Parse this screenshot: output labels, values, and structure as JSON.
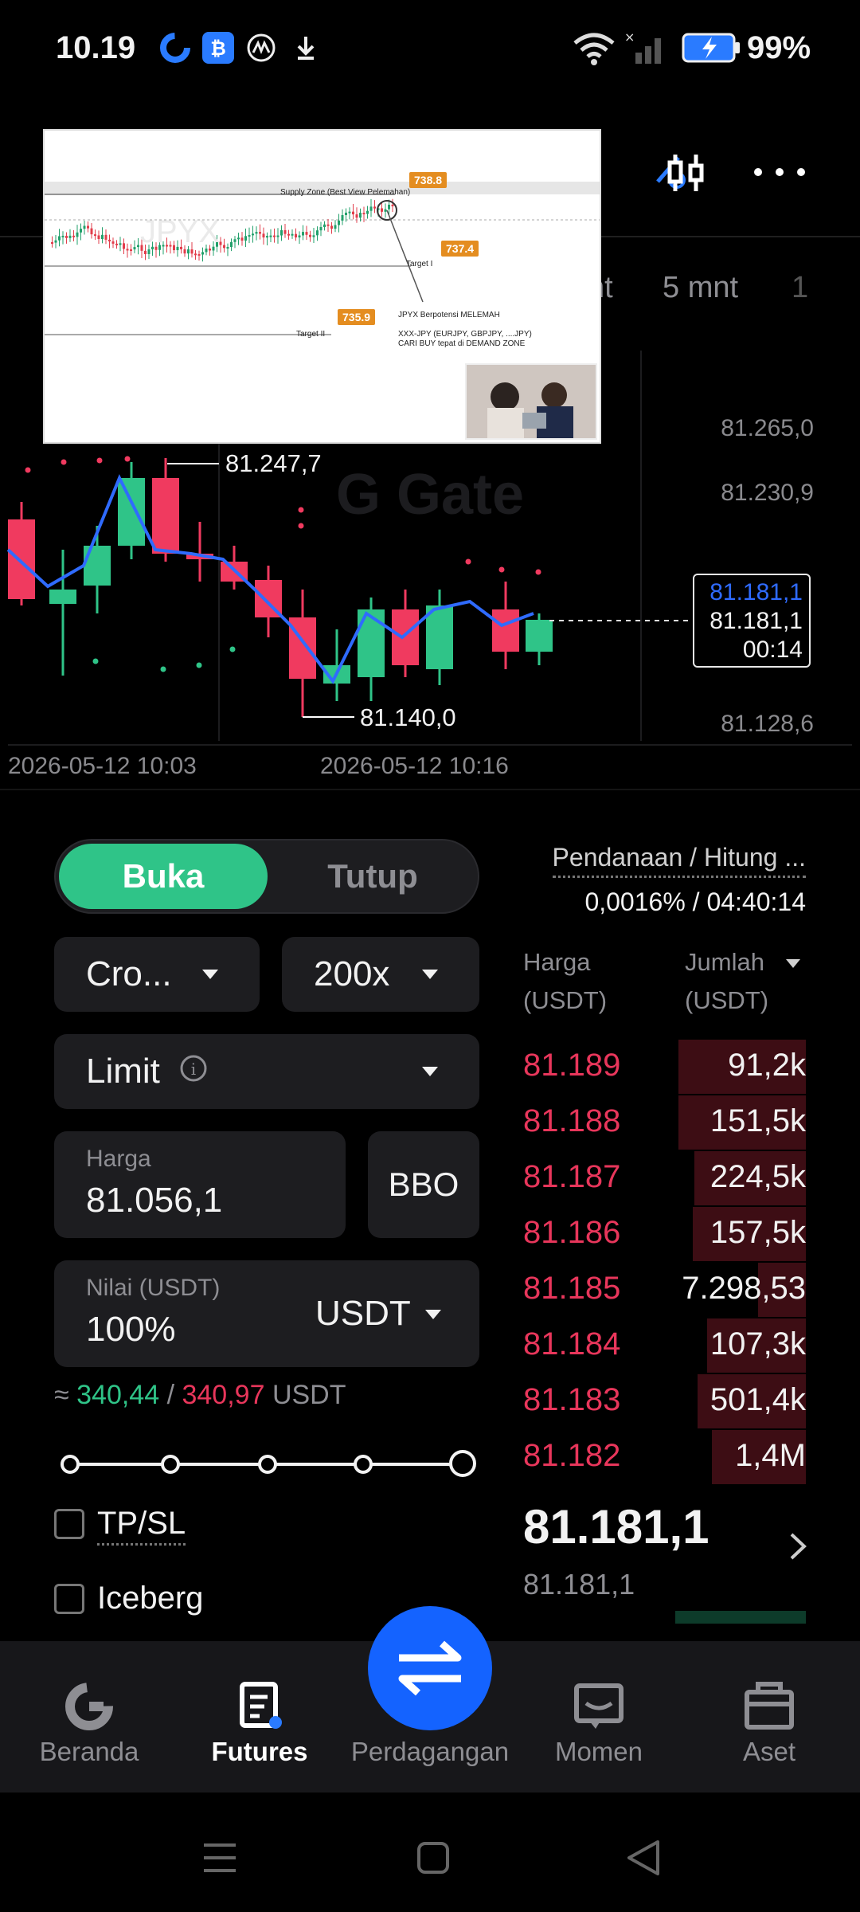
{
  "status_bar": {
    "time": "10.19",
    "battery": "99%"
  },
  "header": {
    "timeframe_tabs": [
      "nt",
      "5 mnt",
      "1"
    ]
  },
  "chart": {
    "price_axis": [
      "81.265,0",
      "81.230,9",
      "81.1??,?",
      "81.1??,?",
      "81.128,6"
    ],
    "high_label": "81.247,7",
    "low_label": "81.140,0",
    "current_blue": "81.181,1",
    "current_white": "81.181,1",
    "countdown": "00:14",
    "time_labels": [
      "2026-05-12 10:03",
      "2026-05-12 10:16"
    ],
    "watermark": "Gate"
  },
  "video_overlay": {
    "supply_zone": "Supply Zone (Best View Pelemahan)",
    "badge_top": "738.8",
    "badge_mid": "737.4",
    "badge_low": "735.9",
    "target1": "Target I",
    "target2": "Target II",
    "pair_watermark": "JPYX",
    "note1": "JPYX Berpotensi MELEMAH",
    "note2": "XXX-JPY (EURJPY, GBPJPY, ....JPY)",
    "note3": "CARI BUY tepat di DEMAND ZONE"
  },
  "form": {
    "tab_open": "Buka",
    "tab_close": "Tutup",
    "margin_mode": "Cro...",
    "leverage": "200x",
    "order_type": "Limit",
    "price_label": "Harga",
    "price_value": "81.056,1",
    "bbo_label": "BBO",
    "value_label": "Nilai (USDT)",
    "value_pct": "100%",
    "value_unit": "USDT",
    "approx_prefix": "≈",
    "approx_long": "340,44",
    "approx_sep": "/",
    "approx_short": "340,97",
    "approx_unit": "USDT",
    "tpsl_label": "TP/SL",
    "iceberg_label": "Iceberg"
  },
  "orderbook": {
    "funding_label": "Pendanaan / Hitung ...",
    "funding_value": "0,0016% / 04:40:14",
    "col_price": "Harga",
    "col_price_unit": "(USDT)",
    "col_amount": "Jumlah",
    "col_amount_unit": "(USDT)",
    "asks": [
      {
        "price": "81.189",
        "qty": "91,2k"
      },
      {
        "price": "81.188",
        "qty": "151,5k"
      },
      {
        "price": "81.187",
        "qty": "224,5k"
      },
      {
        "price": "81.186",
        "qty": "157,5k"
      },
      {
        "price": "81.185",
        "qty": "7.298,53"
      },
      {
        "price": "81.184",
        "qty": "107,3k"
      },
      {
        "price": "81.183",
        "qty": "501,4k"
      },
      {
        "price": "81.182",
        "qty": "1,4M"
      }
    ],
    "last_price": "81.181,1",
    "mark_price": "81.181,1"
  },
  "bottom_nav": {
    "items": [
      "Beranda",
      "Futures",
      "Perdagangan",
      "Momen",
      "Aset"
    ]
  },
  "colors": {
    "accent_green": "#2fc488",
    "ask_red": "#e8365b",
    "blue_fab": "#1463ff"
  }
}
